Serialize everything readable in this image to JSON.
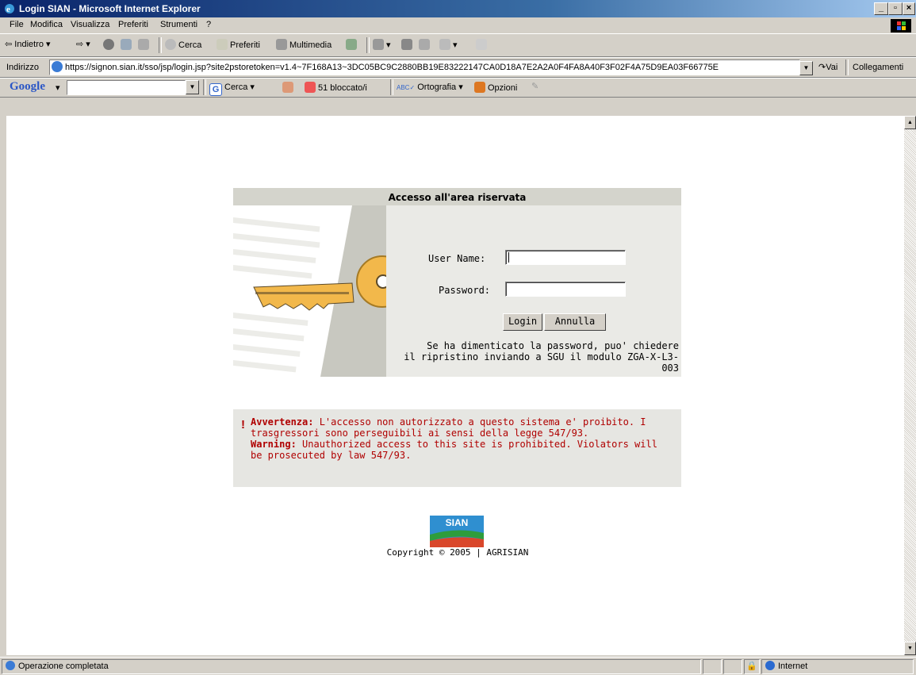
{
  "window": {
    "title": "Login SIAN - Microsoft Internet Explorer"
  },
  "menu": [
    "File",
    "Modifica",
    "Visualizza",
    "Preferiti",
    "Strumenti",
    "?"
  ],
  "toolbar": {
    "back": "Indietro",
    "search": "Cerca",
    "favorites": "Preferiti",
    "media": "Multimedia"
  },
  "address": {
    "label": "Indirizzo",
    "url": "https://signon.sian.it/sso/jsp/login.jsp?site2pstoretoken=v1.4~7F168A13~3DC05BC9C2880BB19E83222147CA0D18A7E2A2A0F4FA8A40F3F02F4A75D9EA03F66775E",
    "go": "Vai",
    "links": "Collegamenti"
  },
  "googlebar": {
    "logo": "Google",
    "search": "Cerca",
    "blocked": "51 bloccato/i",
    "spell": "Ortografia",
    "options": "Opzioni"
  },
  "login": {
    "header": "Accesso all'area riservata",
    "username_label": "User Name:",
    "username_value": "",
    "password_label": "Password:",
    "password_value": "",
    "login_button": "Login",
    "cancel_button": "Annulla",
    "help_line1": "Se ha dimenticato la password, puo' chiedere",
    "help_line2": "il ripristino inviando a SGU il modulo ZGA-X-L3-003"
  },
  "warning": {
    "it_label": "Avvertenza:",
    "it_text": " L'accesso non autorizzato a questo sistema e' proibito. I trasgressori sono perseguibili ai sensi della legge 547/93.",
    "en_label": "Warning:",
    "en_text": " Unauthorized access to this site is prohibited. Violators will be prosecuted by law 547/93."
  },
  "footer": {
    "logo_text": "SIAN",
    "copyright": "Copyright © 2005 | AGRISIAN"
  },
  "status": {
    "text": "Operazione completata",
    "zone": "Internet"
  },
  "colors": {
    "title_bar": "#0a246a",
    "warning": "#b00000",
    "key": "#f2b84b"
  }
}
